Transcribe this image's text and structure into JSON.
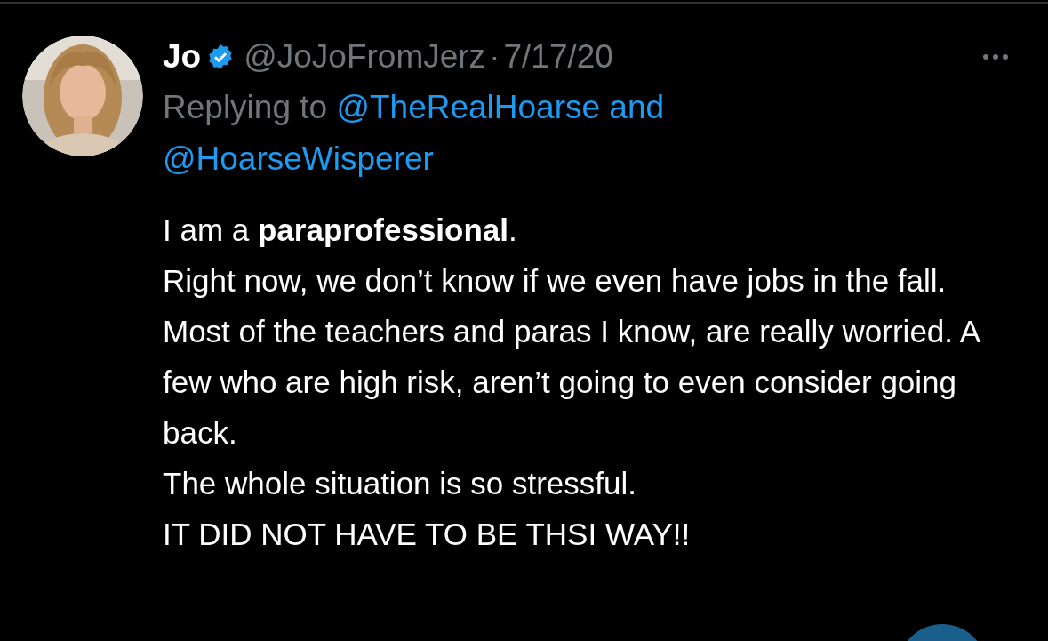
{
  "tweet": {
    "author": {
      "name": "Jo",
      "verified": true,
      "handle": "@JoJoFromJerz",
      "separator": "·",
      "date": "7/17/20"
    },
    "reply_to": {
      "prefix": "Replying to",
      "mentions": [
        "@TheRealHoarse and",
        "@HoarseWisperer"
      ]
    },
    "body": [
      "I am a **paraprofessional**.",
      "Right now, we don’t know if we even have jobs in the fall.",
      "Most of the teachers and paras I know, are really worried. A few who are high risk, aren’t going to even consider going back.",
      "The whole situation is so stressful.",
      "IT DID NOT HAVE TO BE THSI WAY!!"
    ]
  }
}
